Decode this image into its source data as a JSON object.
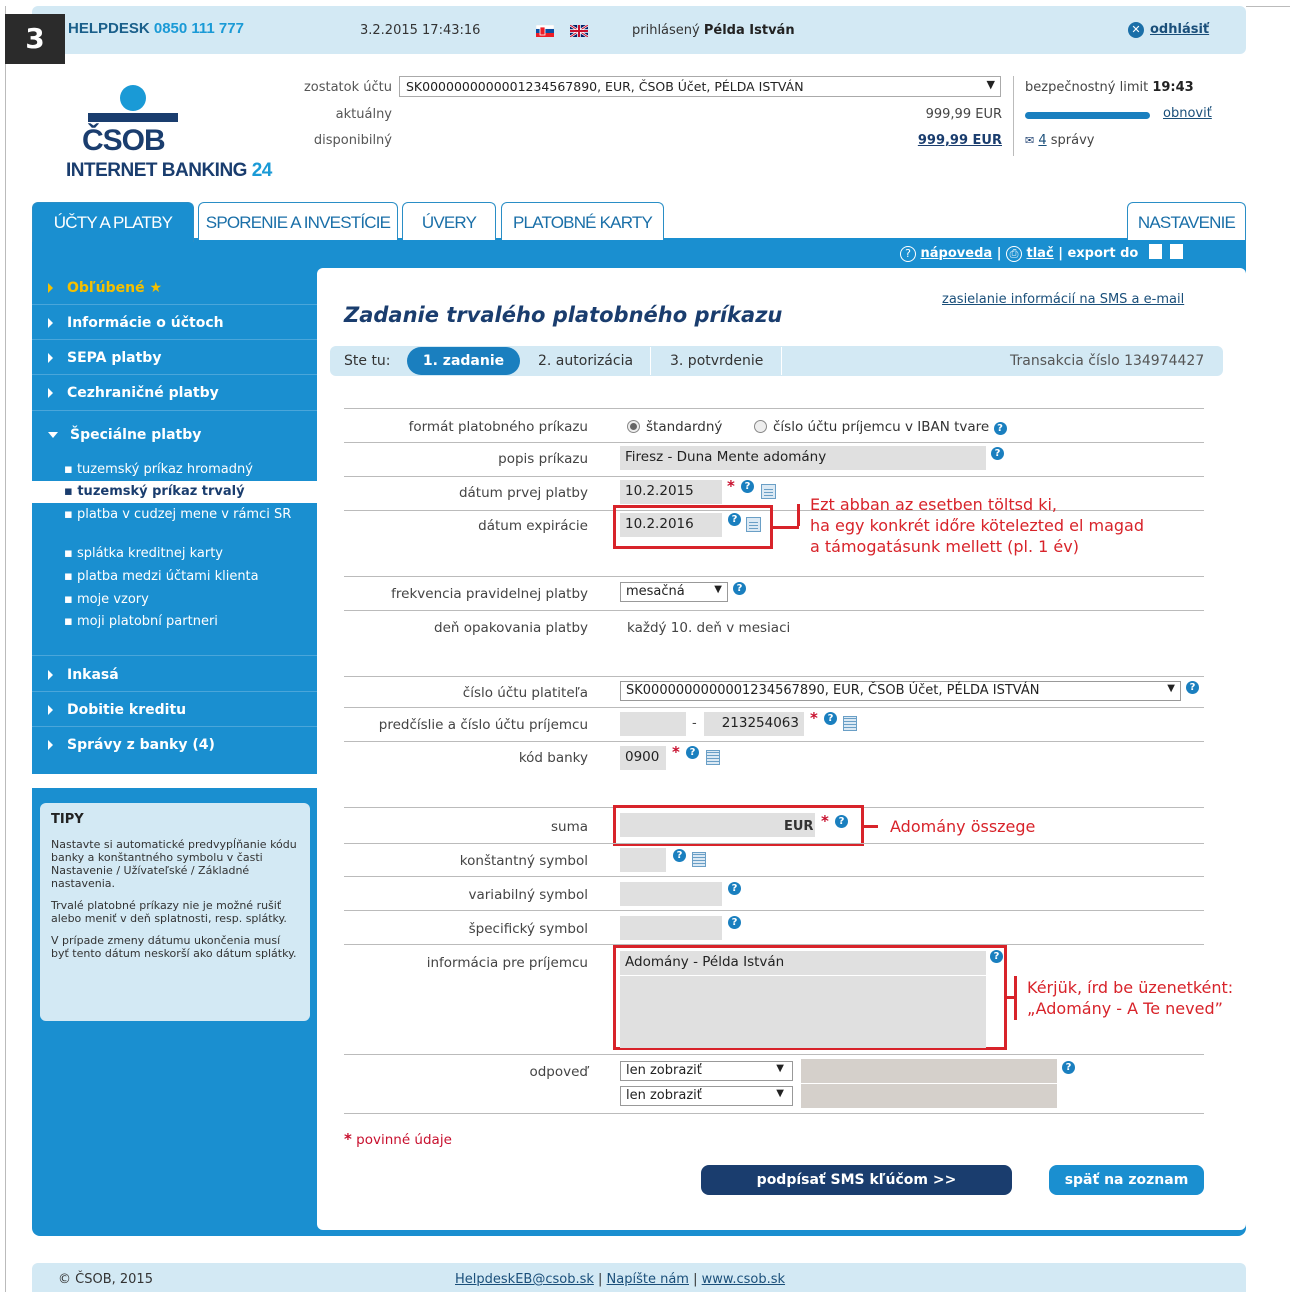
{
  "step_number": "3",
  "header": {
    "helpdesk_label": "HELPDESK",
    "helpdesk_number": "0850 111 777",
    "datetime": "3.2.2015 17:43:16",
    "logged_in_label": "prihlásený",
    "user_name": "Példa István",
    "logout": "odhlásiť"
  },
  "account": {
    "balance_label": "zostatok účtu",
    "selected_account": "SK0000000000001234567890, EUR, ČSOB Účet, PÉLDA ISTVÁN",
    "current_label": "aktuálny",
    "current_value": "999,99 EUR",
    "available_label": "disponibilný",
    "available_value": "999,99 EUR",
    "security_limit_label": "bezpečnostný limit",
    "security_limit_value": "19:43",
    "refresh": "obnoviť",
    "messages_count": "4",
    "messages_label": "správy"
  },
  "logo": {
    "brand": "ČSOB",
    "sub": "INTERNET BANKING",
    "sub_num": "24"
  },
  "tabs": [
    "ÚČTY A PLATBY",
    "SPORENIE A INVESTÍCIE",
    "ÚVERY",
    "PLATOBNÉ KARTY",
    "NASTAVENIE"
  ],
  "tools": {
    "help": "nápoveda",
    "print": "tlač",
    "export": "export do"
  },
  "sidebar": {
    "favorites": "Obľúbené",
    "items": [
      "Informácie o účtoch",
      "SEPA platby",
      "Cezhraničné platby",
      "Špeciálne platby"
    ],
    "sub_items": [
      "tuzemský príkaz hromadný",
      "tuzemský príkaz trvalý",
      "platba v cudzej mene v rámci SR",
      "splátka kreditnej karty",
      "platba medzi účtami klienta",
      "moje vzory",
      "moji platobní partneri"
    ],
    "bottom_items": [
      "Inkasá",
      "Dobitie kreditu",
      "Správy z banky (4)"
    ]
  },
  "tips": {
    "title": "TIPY",
    "p1": "Nastavte si automatické predvypĺňanie kódu banky a konštantného symbolu v časti Nastavenie / Užívateľské / Základné nastavenia.",
    "p2": "Trvalé platobné príkazy nie je možné rušiť alebo meniť v deň splatnosti, resp. splátky.",
    "p3": "V prípade zmeny dátumu ukončenia musí byť tento dátum neskorší ako dátum splátky."
  },
  "form": {
    "sms_link": "zasielanie informácií na SMS a e-mail",
    "title": "Zadanie trvalého platobného príkazu",
    "you_are_here": "Ste tu:",
    "steps": [
      "1. zadanie",
      "2. autorizácia",
      "3. potvrdenie"
    ],
    "transaction": "Transakcia číslo 134974427",
    "format_label": "formát platobného príkazu",
    "format_opt1": "štandardný",
    "format_opt2": "číslo účtu príjemcu v IBAN tvare",
    "desc_label": "popis príkazu",
    "desc_value": "Firesz - Duna Mente adomány",
    "first_date_label": "dátum prvej platby",
    "first_date_value": "10.2.2015",
    "expiry_label": "dátum expirácie",
    "expiry_value": "10.2.2016",
    "freq_label": "frekvencia pravidelnej platby",
    "freq_value": "mesačná",
    "repeat_label": "deň opakovania platby",
    "repeat_value": "každý 10. deň v mesiaci",
    "payer_label": "číslo účtu platiteľa",
    "payer_value": "SK0000000000001234567890, EUR, ČSOB Účet, PÉLDA ISTVÁN",
    "payee_label": "predčíslie a číslo účtu príjemcu",
    "payee_prefix": "",
    "payee_number": "213254063",
    "bank_label": "kód banky",
    "bank_value": "0900",
    "amount_label": "suma",
    "amount_currency": "EUR",
    "const_label": "konštantný symbol",
    "var_label": "variabilný symbol",
    "spec_label": "špecifický symbol",
    "info_label": "informácia pre príjemcu",
    "info_value": "Adomány - Példa István",
    "reply_label": "odpoveď",
    "reply_opt": "len zobraziť",
    "required_note": "povinné údaje",
    "sign_button": "podpísať SMS kľúčom >>",
    "back_button": "späť na zoznam"
  },
  "annotations": {
    "expiry_1": "Ezt abban az esetben töltsd ki,",
    "expiry_2": "ha egy konkrét időre kötelezted el magad",
    "expiry_3": "a támogatásunk mellett (pl. 1 év)",
    "amount": "Adomány összege",
    "info_1": "Kérjük, írd be üzenetként:",
    "info_2": "„Adomány - A Te neved”"
  },
  "footer": {
    "copyright": "© ČSOB, 2015",
    "email": "HelpdeskEB@csob.sk",
    "write": "Napíšte nám",
    "web": "www.csob.sk"
  }
}
